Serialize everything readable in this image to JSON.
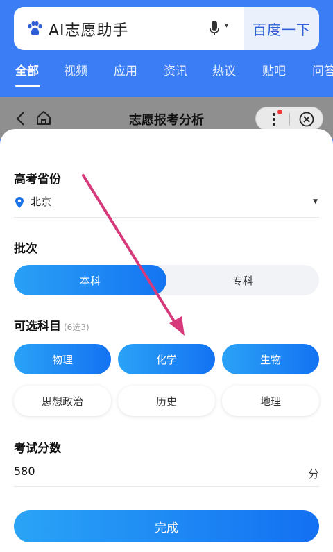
{
  "search": {
    "query": "AI志愿助手",
    "button_label": "百度一下"
  },
  "tabs": [
    {
      "label": "全部",
      "active": true
    },
    {
      "label": "视频",
      "active": false
    },
    {
      "label": "应用",
      "active": false
    },
    {
      "label": "资讯",
      "active": false
    },
    {
      "label": "热议",
      "active": false
    },
    {
      "label": "贴吧",
      "active": false
    },
    {
      "label": "问答",
      "active": false
    }
  ],
  "miniprogram": {
    "title": "志愿报考分析"
  },
  "form": {
    "province_label": "高考省份",
    "province_value": "北京",
    "batch_label": "批次",
    "batch_options": [
      {
        "label": "本科",
        "selected": true
      },
      {
        "label": "专科",
        "selected": false
      }
    ],
    "subjects_label": "可选科目",
    "subjects_hint": "(6选3)",
    "subjects": [
      {
        "label": "物理",
        "selected": true
      },
      {
        "label": "化学",
        "selected": true
      },
      {
        "label": "生物",
        "selected": true
      },
      {
        "label": "思想政治",
        "selected": false
      },
      {
        "label": "历史",
        "selected": false
      },
      {
        "label": "地理",
        "selected": false
      }
    ],
    "score_label": "考试分数",
    "score_value": "580",
    "score_unit": "分",
    "submit_label": "完成"
  },
  "colors": {
    "brand_blue": "#3b7df5",
    "accent": "#1474f2",
    "annotation_arrow": "#d63a7a"
  }
}
